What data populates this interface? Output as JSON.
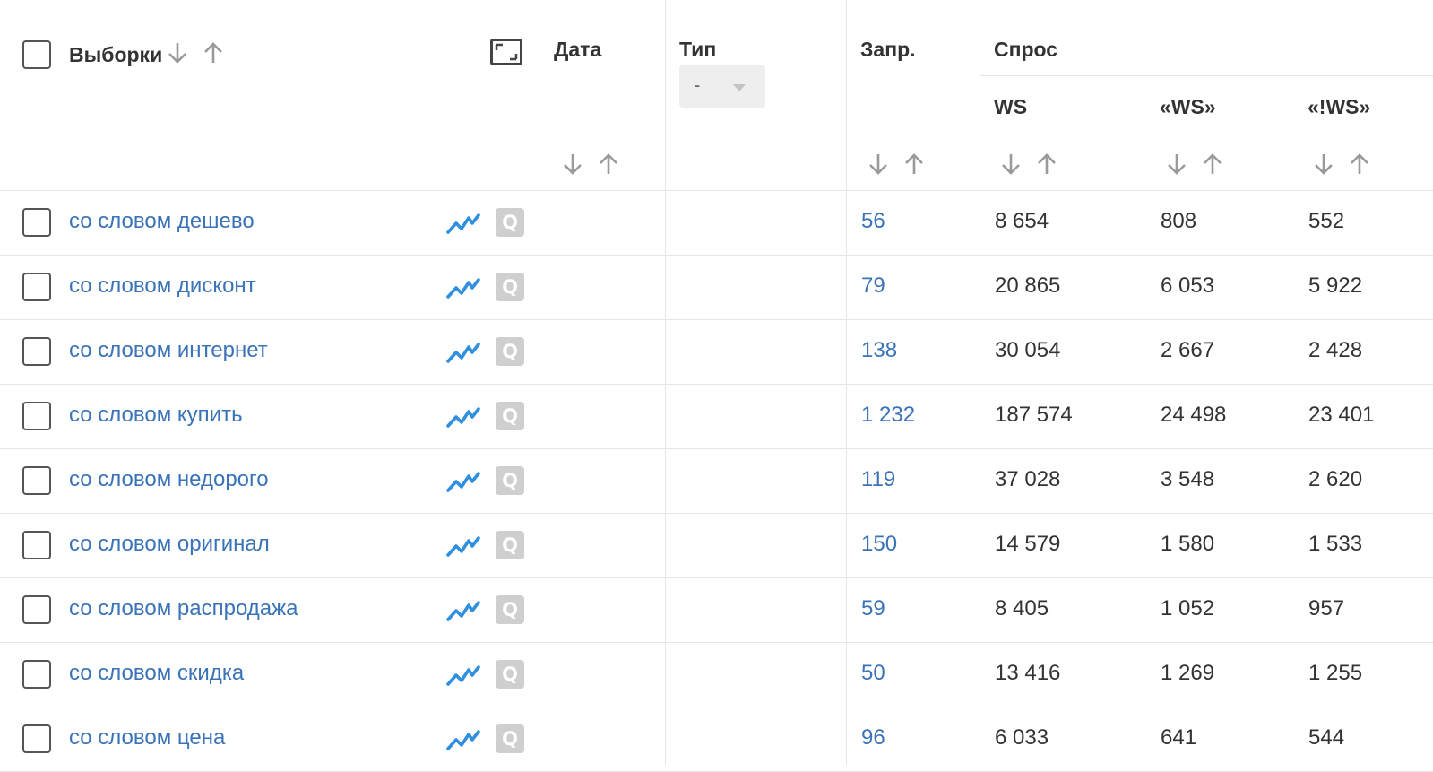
{
  "header": {
    "selections_label": "Выборки",
    "date_label": "Дата",
    "type_label": "Тип",
    "type_select_value": "-",
    "queries_label": "Запр.",
    "demand_label": "Спрос",
    "ws_label": "WS",
    "ws_quoted_label": "«WS»",
    "ws_exact_label": "«!WS»"
  },
  "icons": {
    "sort_desc": "arrow-down-icon",
    "sort_asc": "arrow-up-icon",
    "expand": "expand-icon",
    "trend": "trend-chart-icon",
    "query": "q-icon",
    "trend_color": "#2f8fe0"
  },
  "q_glyph": "Q",
  "rows": [
    {
      "name": "со словом дешево",
      "queries": "56",
      "ws": "8 654",
      "ws_quoted": "808",
      "ws_exact": "552"
    },
    {
      "name": "со словом дисконт",
      "queries": "79",
      "ws": "20 865",
      "ws_quoted": "6 053",
      "ws_exact": "5 922"
    },
    {
      "name": "со словом интернет",
      "queries": "138",
      "ws": "30 054",
      "ws_quoted": "2 667",
      "ws_exact": "2 428"
    },
    {
      "name": "со словом купить",
      "queries": "1 232",
      "ws": "187 574",
      "ws_quoted": "24 498",
      "ws_exact": "23 401"
    },
    {
      "name": "со словом недорого",
      "queries": "119",
      "ws": "37 028",
      "ws_quoted": "3 548",
      "ws_exact": "2 620"
    },
    {
      "name": "со словом оригинал",
      "queries": "150",
      "ws": "14 579",
      "ws_quoted": "1 580",
      "ws_exact": "1 533"
    },
    {
      "name": "со словом распродажа",
      "queries": "59",
      "ws": "8 405",
      "ws_quoted": "1 052",
      "ws_exact": "957"
    },
    {
      "name": "со словом скидка",
      "queries": "50",
      "ws": "13 416",
      "ws_quoted": "1 269",
      "ws_exact": "1 255"
    },
    {
      "name": "со словом цена",
      "queries": "96",
      "ws": "6 033",
      "ws_quoted": "641",
      "ws_exact": "544"
    }
  ]
}
